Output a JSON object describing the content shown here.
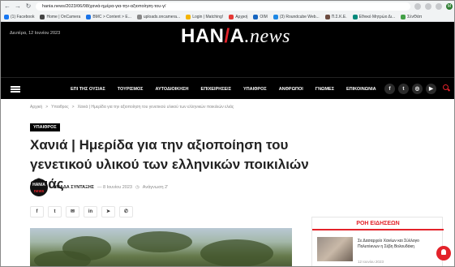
{
  "browser": {
    "url": "hania.news/2023/06/08/χανιά-ημέρα-για-την-αξιοποίηση-του-γ/",
    "bookmarks": [
      {
        "label": "(1) Facebook",
        "color": "#1877f2"
      },
      {
        "label": "Home | OnCamera",
        "color": "#444444"
      },
      {
        "label": "BMC > Content > E...",
        "color": "#1a73e8"
      },
      {
        "label": "uploads.oncamera...",
        "color": "#888888"
      },
      {
        "label": "Login | Matching!",
        "color": "#f4b400"
      },
      {
        "label": "Αρχική",
        "color": "#e53935"
      },
      {
        "label": "OIM",
        "color": "#1565c0"
      },
      {
        "label": "(3) Roundcube Web...",
        "color": "#1e88e5"
      },
      {
        "label": "Π.Σ.Κ.Ε.",
        "color": "#6d4c41"
      },
      {
        "label": "Εθνικό Μητρώο Δι...",
        "color": "#00897b"
      },
      {
        "label": "ΣένΘάπ",
        "color": "#43a047"
      }
    ]
  },
  "header": {
    "date": "Δευτέρα, 12 Ιουνίου 2023",
    "logo_main": "HAN",
    "logo_slash": "/",
    "logo_tail": "A",
    "logo_suffix": ".news",
    "menu": [
      "ΕΠΙ ΤΗΣ ΟΥΣΙΑΣ",
      "ΤΟΥΡΙΣΜΟΣ",
      "ΑΥΤΟΔΙΟΙΚΗΣΗ",
      "ΕΠΙΧΕΙΡΗΣΕΙΣ",
      "ΥΠΑΙΘΡΟΣ",
      "ΑΝΘΡΩΠΟΙ",
      "ΓΝΩΜΕΣ",
      "ΕΠΙΚΟΙΝΩΝΙΑ"
    ],
    "social_glyphs": [
      "f",
      "t",
      "◎",
      "▶"
    ]
  },
  "article": {
    "breadcrumb": [
      "Αρχική",
      "Υπαιθρος",
      "Χανιά | Ημερίδα για την αξιοποίηση του γενετικού υλικού των ελληνικών ποικιλιών ελιάς"
    ],
    "category": "ΥΠΑΙΘΡΟΣ",
    "title": "Χανιά | Ημερίδα για την αξιοποίηση του γενετικού υλικού των ελληνικών ποικιλιών ελιάς",
    "avatar_top": "HAN/A",
    "avatar_bottom": "news",
    "author": "ΟΜΑΔΑ ΣΥΝΤΑΞΗΣ",
    "date": "— 8 Ιουνίου 2023",
    "reading": "Ανάγνωση 2'",
    "share_glyphs": [
      "f",
      "t",
      "✉",
      "in",
      "➤",
      "✆"
    ]
  },
  "sidebar": {
    "title": "ΡΟΗ ΕΙΔΗΣΕΩΝ",
    "headline": "Σε Δασαρχείο Χανίων και Σύλλογο Πολυτέκνων η Σέβη Βολουδάκη",
    "date": "12 Ιουνίου 2023"
  }
}
